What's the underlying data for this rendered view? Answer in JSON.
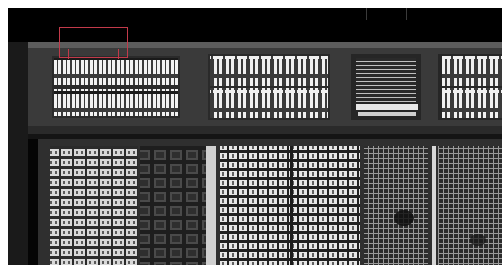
{
  "view": {
    "background": "#050505",
    "frame_color": "#ffffff",
    "selection_color": "#c23a4a"
  }
}
